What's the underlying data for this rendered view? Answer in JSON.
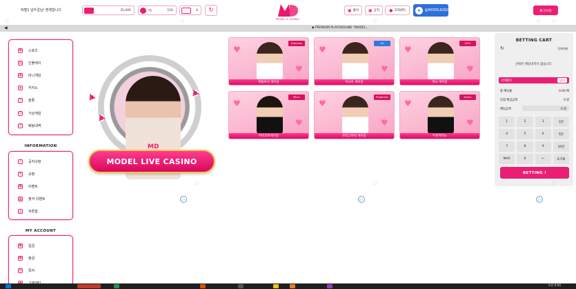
{
  "header": {
    "welcome": "레벨1 널두걸님! 환영합니다",
    "money_value": "35,095",
    "point_value": "150",
    "message_count": "0",
    "logo_text": "MD",
    "logo_sub": "MODEL & CASINO",
    "btn_attendance": "출석",
    "btn_notice": "공지",
    "btn_support": "고객센터",
    "telegram_label": "@MODEL8282",
    "login_label": "로그아웃"
  },
  "ticker": {
    "text": "◆ PREMIUM PLAYGROUND \"MODEL..."
  },
  "sidebar": {
    "main_items": [
      {
        "label": "스포츠",
        "icon": "ball-icon"
      },
      {
        "label": "인플레이",
        "icon": "tv-icon"
      },
      {
        "label": "미니게임",
        "icon": "game-icon"
      },
      {
        "label": "카지노",
        "icon": "card-icon"
      },
      {
        "label": "슬롯",
        "icon": "slot-icon"
      },
      {
        "label": "가상게임",
        "icon": "virtual-icon"
      },
      {
        "label": "배팅내역",
        "icon": "history-icon"
      }
    ],
    "info_title": "INFORMATION",
    "info_items": [
      {
        "label": "공지사항",
        "icon": "bell-icon"
      },
      {
        "label": "규정",
        "icon": "rule-icon"
      },
      {
        "label": "이벤트",
        "icon": "gift-icon"
      },
      {
        "label": "출석 이벤트",
        "icon": "calendar-icon"
      },
      {
        "label": "쿠폰함",
        "icon": "coupon-icon"
      }
    ],
    "account_title": "MY ACCOUNT",
    "account_items": [
      {
        "label": "입금",
        "icon": "deposit-icon"
      },
      {
        "label": "출금",
        "icon": "withdraw-icon"
      },
      {
        "label": "쪽지",
        "icon": "message-icon"
      },
      {
        "label": "고객센터",
        "icon": "support-icon"
      }
    ]
  },
  "banner": {
    "title": "MODEL LIVE CASINO",
    "logo": "MD"
  },
  "games": [
    {
      "label": "에볼루션 게이밍",
      "tag": "Evolution"
    },
    {
      "label": "아시아 게이밍",
      "tag": "AG"
    },
    {
      "label": "섹시 게이밍",
      "tag": "SEXY"
    },
    {
      "label": "마이크로게이밍",
      "tag": "Micro"
    },
    {
      "label": "프라그마틱 게이밍",
      "tag": "Pragmatic"
    },
    {
      "label": "두윈카지노",
      "tag": "Dowin"
    }
  ],
  "cart": {
    "title": "BETTING CART",
    "delete_all": "전체삭제",
    "empty_msg": "선택된 배팅내역이 없습니다.",
    "selected_label": "선택폴더",
    "close_label": "닫다",
    "total_odds_label": "총 배당율",
    "total_odds_value": "0.00 배",
    "expected_label": "당첨 예상금액",
    "expected_value": "0 원",
    "bet_amount_label": "배팅금액",
    "bet_amount_value": "0 원",
    "keys": [
      "1",
      "2",
      "3",
      "1만",
      "4",
      "5",
      "6",
      "5만",
      "7",
      "8",
      "9",
      "10만",
      "MAX",
      "0",
      "←",
      "초기화"
    ],
    "bet_button": "BETTING !"
  },
  "taskbar": {
    "clock": "오전 9:00"
  },
  "colors": {
    "accent": "#ea1f73",
    "telegram": "#2f6fd9"
  }
}
